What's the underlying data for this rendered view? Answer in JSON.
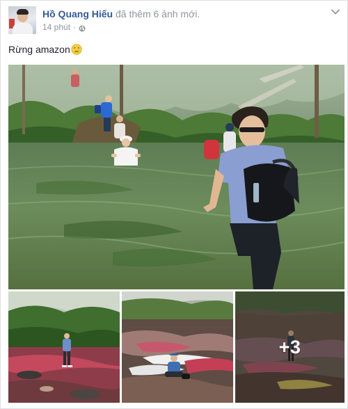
{
  "post": {
    "author": "Hồ Quang Hiếu",
    "action": "đã thêm 6 ảnh mới.",
    "timestamp": "14 phút",
    "separator": "·",
    "privacy_icon": "globe-icon",
    "message": "Rừng amazon",
    "message_emoji": "crying-face-emoji",
    "menu_icon": "chevron-down-icon"
  },
  "photos": {
    "main": "photo-group-wading-river",
    "thumbnails": [
      "photo-man-on-rocks",
      "photo-man-sitting-river",
      "photo-more"
    ],
    "more_count": "+3"
  },
  "colors": {
    "author_link": "#365899",
    "secondary_text": "#90949c",
    "body_text": "#1d2129",
    "border": "#dddfe2"
  }
}
